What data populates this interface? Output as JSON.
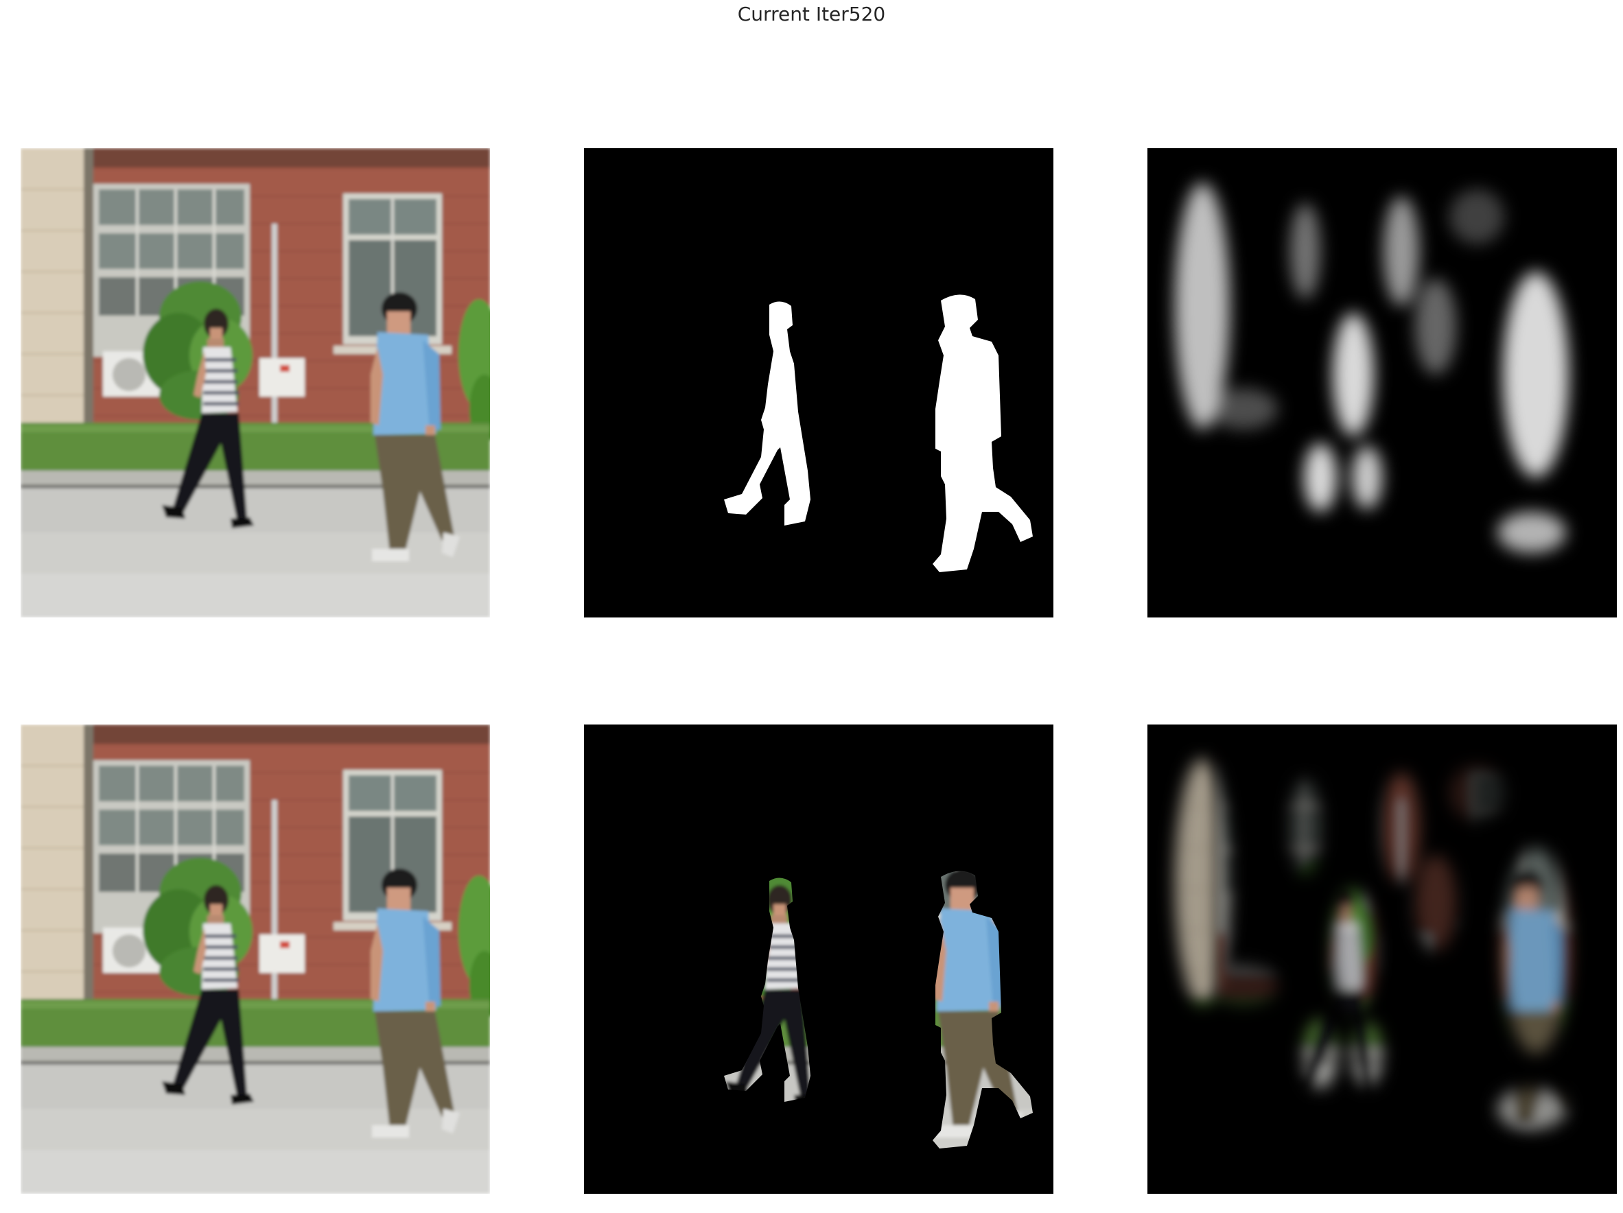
{
  "title": "Current Iter520",
  "panels": [
    {
      "row": 1,
      "col": 1,
      "kind": "input-image"
    },
    {
      "row": 1,
      "col": 2,
      "kind": "ground-truth-mask"
    },
    {
      "row": 1,
      "col": 3,
      "kind": "predicted-mask"
    },
    {
      "row": 2,
      "col": 1,
      "kind": "input-image"
    },
    {
      "row": 2,
      "col": 2,
      "kind": "masked-image-ground-truth"
    },
    {
      "row": 2,
      "col": 3,
      "kind": "masked-image-prediction"
    }
  ]
}
